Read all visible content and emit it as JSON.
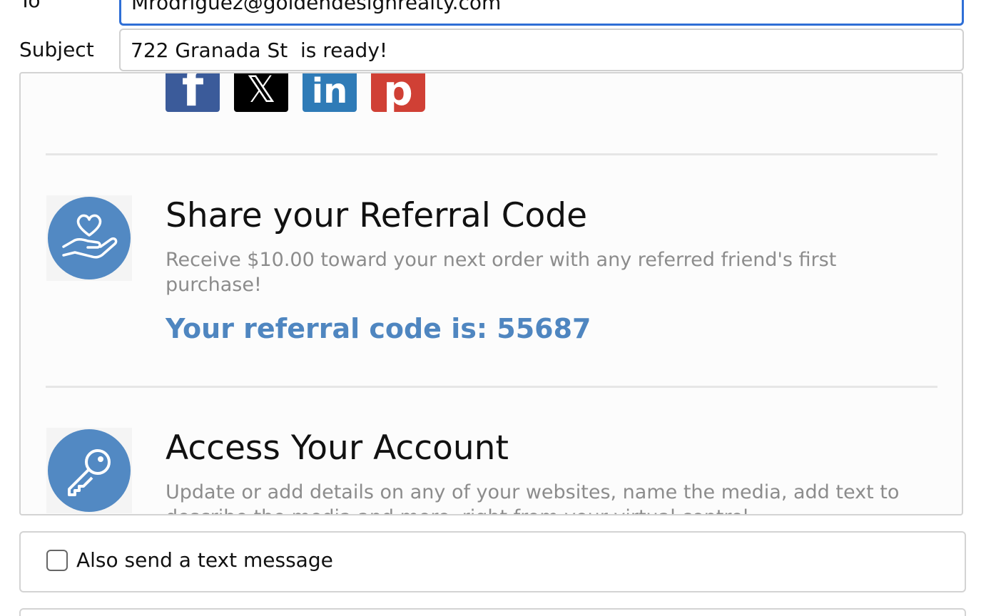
{
  "form": {
    "to_label": "To",
    "to_value": "Mrodriguez@goldendesignrealty.com",
    "subject_label": "Subject",
    "subject_value": "722 Granada St  is ready!"
  },
  "preview": {
    "social_icons": [
      {
        "name": "facebook-icon",
        "glyph": "f"
      },
      {
        "name": "x-icon",
        "glyph": "𝕏"
      },
      {
        "name": "linkedin-icon",
        "glyph": "in"
      },
      {
        "name": "pinterest-icon",
        "glyph": "p"
      }
    ],
    "referral": {
      "icon": "heart-hand-icon",
      "title": "Share your Referral Code",
      "description": "Receive $10.00 toward your next order with any referred friend's first purchase!",
      "code_text": "Your referral code is: 55687"
    },
    "account": {
      "icon": "key-icon",
      "title": "Access Your Account",
      "description": "Update or add details on any of your websites, name the media, add text to describe the media and more, right from your virtual control"
    }
  },
  "sms": {
    "label": "Also send a text message",
    "checked": false
  },
  "colors": {
    "accent": "#2f6fd6",
    "icon_blue": "#5289c3",
    "referral_code": "#4f86c0",
    "muted_text": "#8c8c8c"
  }
}
